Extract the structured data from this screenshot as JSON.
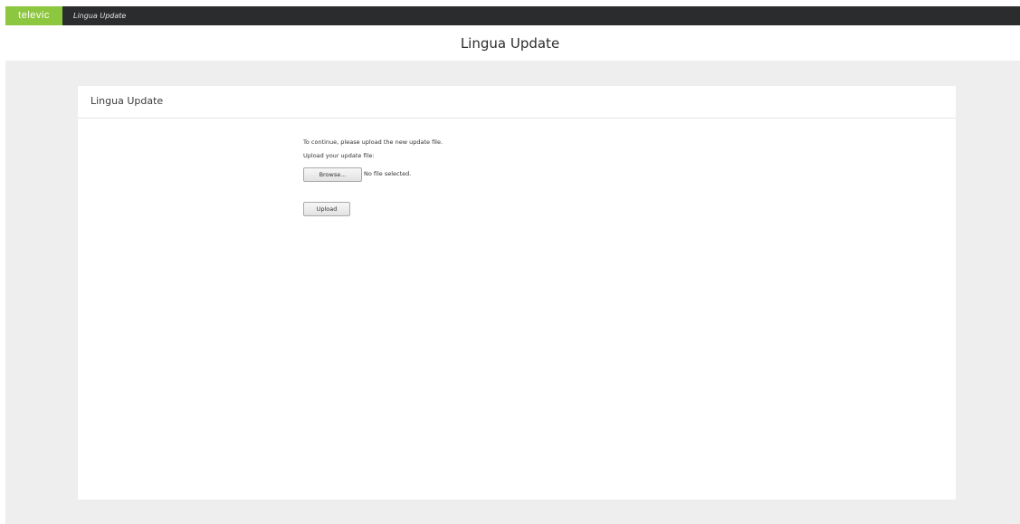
{
  "topbar": {
    "brand": "televic",
    "breadcrumb": "Lingua Update"
  },
  "page": {
    "title": "Lingua Update"
  },
  "panel": {
    "title": "Lingua Update",
    "instruction": "To continue, please upload the new update file.",
    "upload_label": "Upload your update file:",
    "browse_label": "Browse...",
    "file_status": "No file selected.",
    "upload_button": "Upload"
  },
  "colors": {
    "brand": "#8dc63f",
    "topbar": "#2b2c2e",
    "background": "#eeeeee"
  }
}
